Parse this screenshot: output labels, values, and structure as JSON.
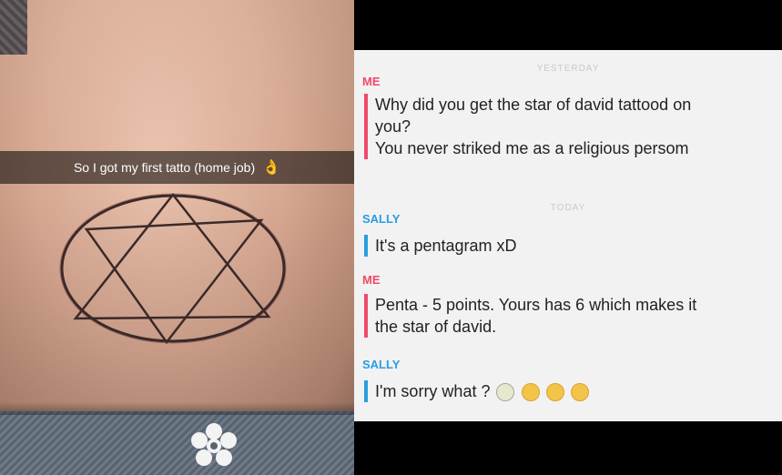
{
  "photo": {
    "caption": "So I got my first tatto (home job)",
    "caption_icon": "ok-hand-icon"
  },
  "chat": {
    "day_labels": [
      "YESTERDAY",
      "TODAY"
    ],
    "messages": [
      {
        "sender": "ME",
        "lines": [
          "Why did you get the star of david tattood on",
          "you?",
          "You never striked me as a religious persom"
        ]
      },
      {
        "sender": "SALLY",
        "lines": [
          "It's a pentagram xD"
        ]
      },
      {
        "sender": "ME",
        "lines": [
          "Penta - 5 points. Yours has 6 which makes it",
          "the star of david."
        ]
      },
      {
        "sender": "SALLY",
        "lines": [
          "I'm sorry what ?"
        ],
        "emojis": [
          "screaming-face-icon",
          "flushed-face-icon",
          "flushed-face-icon",
          "flushed-face-icon"
        ]
      }
    ]
  },
  "colors": {
    "me_accent": "#ef4a6b",
    "sally_accent": "#2a9de0",
    "chat_bg": "#f2f2f2"
  }
}
